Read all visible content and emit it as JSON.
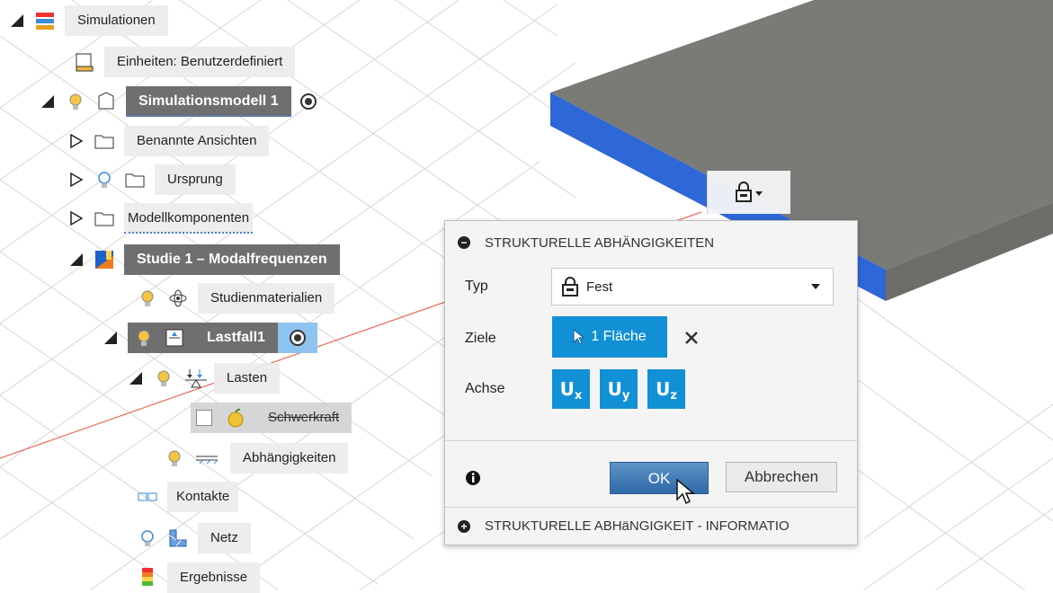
{
  "browser": {
    "root": "Simulationen",
    "units": "Einheiten: Benutzerdefiniert",
    "model": "Simulationsmodell 1",
    "named_views": "Benannte Ansichten",
    "origin": "Ursprung",
    "components": "Modellkomponenten",
    "study": "Studie 1 – Modalfrequenzen",
    "materials": "Studienmaterialien",
    "loadcase": "Lastfall1",
    "loads": "Lasten",
    "gravity": "Schwerkraft",
    "constraints": "Abhängigkeiten",
    "contacts": "Kontakte",
    "mesh": "Netz",
    "results": "Ergebnisse"
  },
  "dialog": {
    "header": "STRUKTURELLE ABHÄNGIGKEITEN",
    "type_label": "Typ",
    "type_value": "Fest",
    "targets_label": "Ziele",
    "targets_value": "1 Fläche",
    "axis_label": "Achse",
    "axis_buttons": [
      {
        "letter": "U",
        "sub": "x"
      },
      {
        "letter": "U",
        "sub": "y"
      },
      {
        "letter": "U",
        "sub": "z"
      }
    ],
    "ok": "OK",
    "cancel": "Abbrechen",
    "footer": "STRUKTURELLE ABHäNGIGKEIT - INFORMATIO"
  },
  "colors": {
    "accent_blue": "#1190d6",
    "plate_top": "#7b7b78",
    "plate_side": "#2e67d6",
    "selected_node": "#6f6f6f"
  }
}
